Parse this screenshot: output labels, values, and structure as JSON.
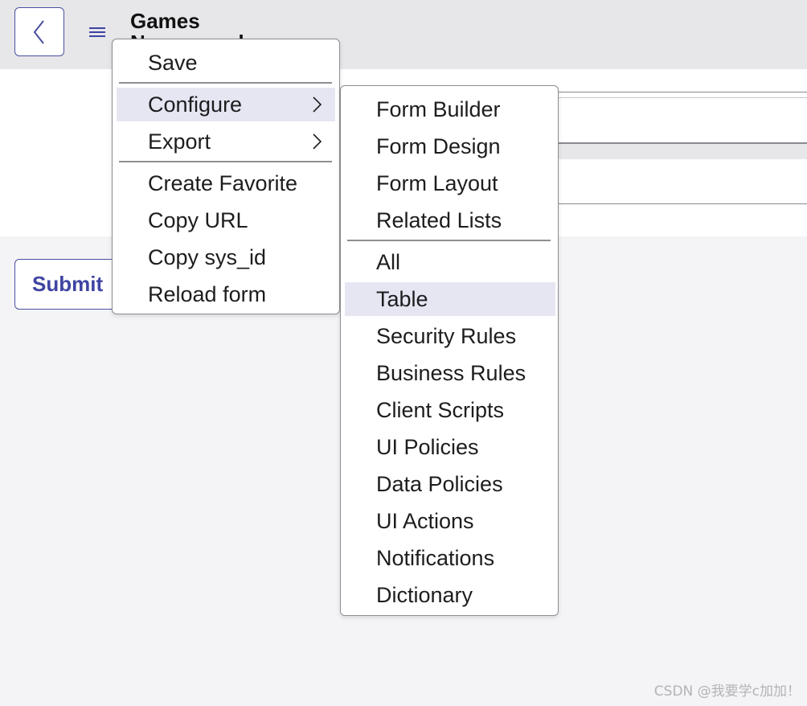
{
  "header": {
    "title": "Games",
    "subtitle": "New record",
    "back_icon": "chevron-left-icon",
    "menu_icon": "hamburger-menu-icon"
  },
  "form": {
    "submit_label": "Submit"
  },
  "context_menu": {
    "items": [
      {
        "label": "Save"
      },
      {
        "label": "Configure",
        "has_submenu": true
      },
      {
        "label": "Export",
        "has_submenu": true
      },
      {
        "label": "Create Favorite"
      },
      {
        "label": "Copy URL"
      },
      {
        "label": "Copy sys_id"
      },
      {
        "label": "Reload form"
      }
    ],
    "active_item": "Configure"
  },
  "configure_submenu": {
    "items": [
      {
        "label": "Form Builder"
      },
      {
        "label": "Form Design"
      },
      {
        "label": "Form Layout"
      },
      {
        "label": "Related Lists"
      },
      {
        "label": "All"
      },
      {
        "label": "Table"
      },
      {
        "label": "Security Rules"
      },
      {
        "label": "Business Rules"
      },
      {
        "label": "Client Scripts"
      },
      {
        "label": "UI Policies"
      },
      {
        "label": "Data Policies"
      },
      {
        "label": "UI Actions"
      },
      {
        "label": "Notifications"
      },
      {
        "label": "Dictionary"
      }
    ],
    "active_item": "Table"
  },
  "watermark": "CSDN @我要学c加加！",
  "colors": {
    "accent": "#3f44a3",
    "header_bg": "#e7e7ea",
    "page_bg": "#f4f4f6",
    "highlight": "#e6e6f3",
    "border": "#8e8e93"
  }
}
